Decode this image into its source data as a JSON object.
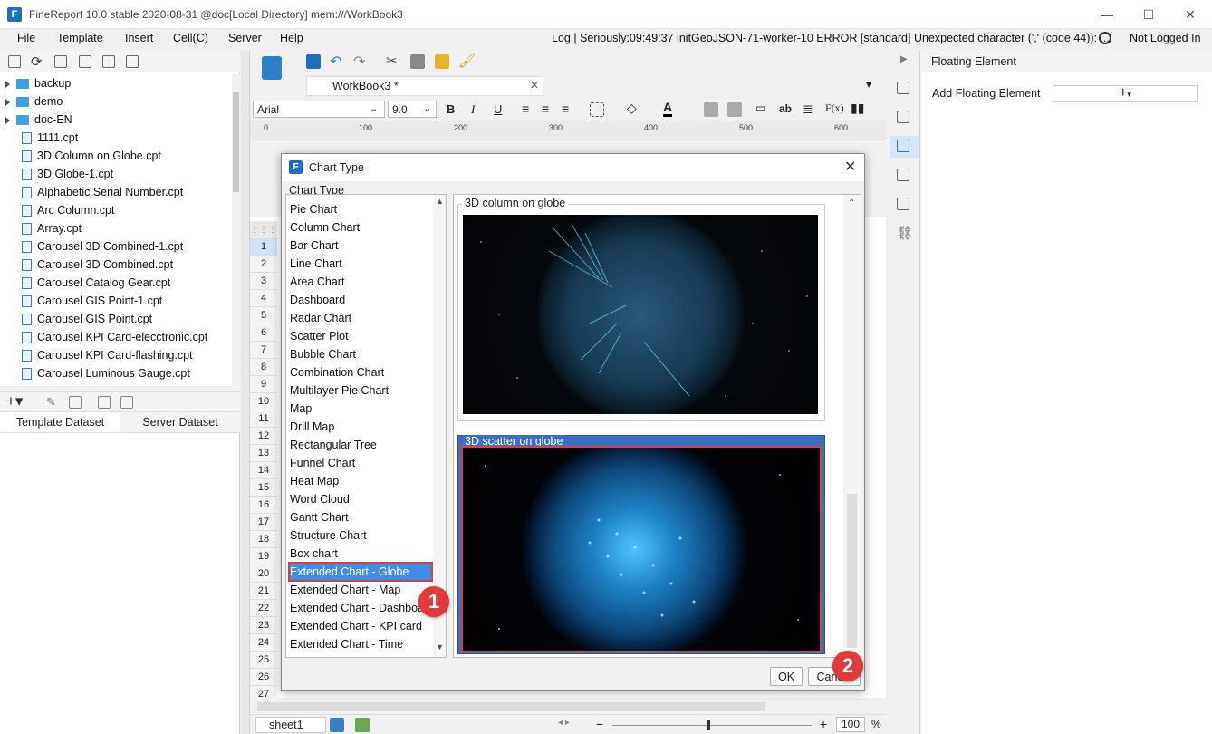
{
  "window": {
    "title": "FineReport 10.0 stable 2020-08-31 @doc[Local Directory]     mem:///WorkBook3",
    "logo": "F"
  },
  "menu": [
    "File",
    "Template",
    "Insert",
    "Cell(C)",
    "Server",
    "Help"
  ],
  "log": "Log | Seriously:09:49:37 initGeoJSON-71-worker-10 ERROR [standard] Unexpected character (',' (code 44)): ...",
  "login_status": "Not Logged In",
  "tree": {
    "folders": [
      "backup",
      "demo",
      "doc-EN"
    ],
    "files": [
      "1111.cpt",
      "3D Column on Globe.cpt",
      "3D Globe-1.cpt",
      "Alphabetic Serial Number.cpt",
      "Arc Column.cpt",
      "Array.cpt",
      "Carousel 3D Combined-1.cpt",
      "Carousel 3D Combined.cpt",
      "Carousel Catalog Gear.cpt",
      "Carousel GIS Point-1.cpt",
      "Carousel GIS Point.cpt",
      "Carousel KPI Card-elecctronic.cpt",
      "Carousel KPI Card-flashing.cpt",
      "Carousel Luminous Gauge.cpt"
    ]
  },
  "dataset_tabs": [
    "Template Dataset",
    "Server Dataset"
  ],
  "editor": {
    "tab": "WorkBook3 *",
    "font": "Arial",
    "font_size": "9.0",
    "ruler": [
      "0",
      "100",
      "200",
      "300",
      "400",
      "500",
      "600"
    ],
    "rows": [
      "1",
      "2",
      "3",
      "4",
      "5",
      "6",
      "7",
      "8",
      "9",
      "10",
      "11",
      "12",
      "13",
      "14",
      "15",
      "16",
      "17",
      "18",
      "19",
      "20",
      "21",
      "22",
      "23",
      "24",
      "25",
      "26",
      "27"
    ],
    "sheet": "sheet1",
    "zoom": "100",
    "zoom_unit": "%"
  },
  "right_panel": {
    "title": "Floating Element",
    "add_label": "Add Floating Element"
  },
  "dialog": {
    "title": "Chart Type",
    "group_label": "Chart Type",
    "chart_types": [
      "Pie Chart",
      "Column Chart",
      "Bar Chart",
      "Line Chart",
      "Area Chart",
      "Dashboard",
      "Radar Chart",
      "Scatter Plot",
      "Bubble Chart",
      "Combination Chart",
      "Multilayer Pie Chart",
      "Map",
      "Drill Map",
      "Rectangular Tree",
      "Funnel Chart",
      "Heat Map",
      "Word Cloud",
      "Gantt Chart",
      "Structure Chart",
      "Box chart",
      "Extended Chart - Globe",
      "Extended Chart - Map",
      "Extended Chart - Dashboard",
      "Extended Chart - KPI card",
      "Extended Chart - Time"
    ],
    "selected_index": 20,
    "previews": [
      "3D column on globe",
      "3D scatter on globe"
    ],
    "ok_label": "OK",
    "cancel_label": "Cancel"
  },
  "badges": [
    "1",
    "2"
  ],
  "colors": {
    "selection_blue": "#3d8ee6",
    "highlight_red": "#e03a4b",
    "accent": "#1b6fc7"
  }
}
